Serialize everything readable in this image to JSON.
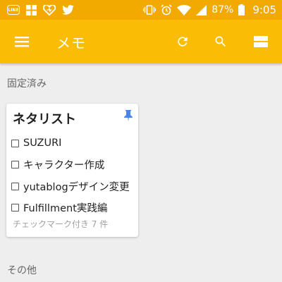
{
  "status_bar": {
    "left_icons": [
      "line-icon",
      "windows-icon",
      "heart-icon",
      "twitter-icon"
    ],
    "line_badge": "LINE",
    "right_icons": [
      "vibrate-icon",
      "alarm-icon",
      "wifi-icon",
      "signal-icon",
      "battery-icon"
    ],
    "battery_percent": "87%",
    "time": "9:05"
  },
  "app_bar": {
    "title": "メモ",
    "actions": [
      "refresh-icon",
      "search-icon",
      "view-toggle-icon"
    ]
  },
  "sections": {
    "pinned": "固定済み",
    "other": "その他"
  },
  "pinned_note": {
    "title": "ネタリスト",
    "pinned": true,
    "items": [
      {
        "text": "SUZURI",
        "checked": false
      },
      {
        "text": "キャラクター作成",
        "checked": false
      },
      {
        "text": "yutablogデザイン変更",
        "checked": false
      },
      {
        "text": "Fulfillment実践編",
        "checked": false
      }
    ],
    "checked_summary": "チェックマーク付き 7 件"
  },
  "colors": {
    "status_bar": "#f2a900",
    "app_bar": "#fbbc05",
    "pin": "#4a86e8",
    "background": "#eeeeee"
  }
}
